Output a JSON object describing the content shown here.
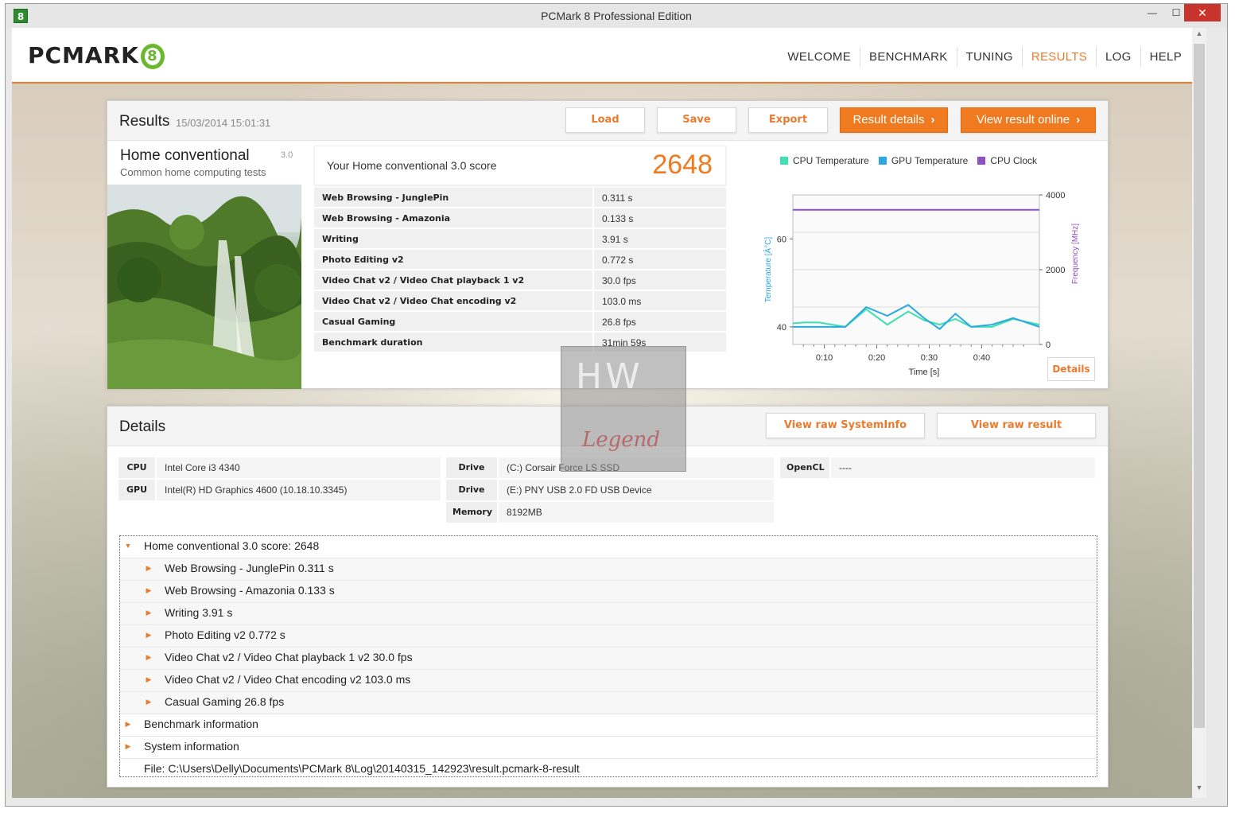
{
  "window": {
    "title": "PCMark 8 Professional Edition",
    "icon_label": "8",
    "controls": {
      "minimize": "—",
      "maximize": "☐",
      "close": "✕"
    }
  },
  "header": {
    "logo_text": "PCMARK",
    "logo_badge": "8",
    "nav": [
      {
        "label": "WELCOME"
      },
      {
        "label": "BENCHMARK"
      },
      {
        "label": "TUNING"
      },
      {
        "label": "RESULTS"
      },
      {
        "label": "LOG"
      },
      {
        "label": "HELP"
      }
    ],
    "active_nav": "RESULTS"
  },
  "results": {
    "title": "Results",
    "date": "15/03/2014 15:01:31",
    "buttons": {
      "load": "Load",
      "save": "Save",
      "export": "Export",
      "result_details": "Result details",
      "view_online": "View result online"
    },
    "test": {
      "name": "Home conventional",
      "version": "3.0",
      "subtitle": "Common home computing tests"
    },
    "score_label": "Your Home conventional 3.0 score",
    "score_value": "2648",
    "rows": [
      {
        "name": "Web Browsing - JunglePin",
        "value": "0.311 s"
      },
      {
        "name": "Web Browsing - Amazonia",
        "value": "0.133 s"
      },
      {
        "name": "Writing",
        "value": "3.91 s"
      },
      {
        "name": "Photo Editing v2",
        "value": "0.772 s"
      },
      {
        "name": "Video Chat v2 / Video Chat playback 1 v2",
        "value": "30.0 fps"
      },
      {
        "name": "Video Chat v2 / Video Chat encoding v2",
        "value": "103.0 ms"
      },
      {
        "name": "Casual Gaming",
        "value": "26.8 fps"
      },
      {
        "name": "Benchmark duration",
        "value": "31min 59s"
      }
    ],
    "chart_details_btn": "Details"
  },
  "chart_data": {
    "type": "line",
    "legend": [
      {
        "name": "CPU Temperature",
        "color": "#3de0b0"
      },
      {
        "name": "GPU Temperature",
        "color": "#29a9e0"
      },
      {
        "name": "CPU Clock",
        "color": "#8e4fc8"
      }
    ],
    "xlabel": "Time [s]",
    "ylabel_left": "Temperature [Â°C]",
    "ylabel_right": "Frequency [MHz]",
    "x_ticks": [
      "0:10",
      "0:20",
      "0:30",
      "0:40"
    ],
    "y_left_ticks": [
      "60",
      "40"
    ],
    "y_right_ticks": [
      "4000",
      "2000",
      "0"
    ],
    "y_left_range": [
      36,
      70
    ],
    "y_right_range": [
      0,
      4000
    ],
    "x_range_s": [
      4,
      51
    ],
    "series": [
      {
        "name": "CPU Temperature",
        "axis": "left",
        "x": [
          4,
          6,
          9,
          14,
          18,
          22,
          26,
          29,
          32,
          35,
          38,
          42,
          46,
          51
        ],
        "y": [
          40.8,
          41.0,
          41.0,
          40.0,
          44.0,
          40.5,
          43.5,
          41.5,
          40.5,
          41.8,
          40.0,
          40.0,
          41.8,
          40.5
        ]
      },
      {
        "name": "GPU Temperature",
        "axis": "left",
        "x": [
          4,
          6,
          9,
          14,
          18,
          22,
          26,
          29,
          32,
          35,
          38,
          42,
          46,
          51
        ],
        "y": [
          40.0,
          40.0,
          40.0,
          40.0,
          44.5,
          42.5,
          45.0,
          42.0,
          39.5,
          43.0,
          40.0,
          40.5,
          42.0,
          40.0
        ]
      },
      {
        "name": "CPU Clock",
        "axis": "right",
        "x": [
          4,
          51
        ],
        "y": [
          3600,
          3600
        ]
      }
    ]
  },
  "details": {
    "title": "Details",
    "buttons": {
      "raw_systeminfo": "View raw SystemInfo",
      "raw_result": "View raw result"
    },
    "system": {
      "cpu_label": "CPU",
      "cpu_value": "Intel Core i3 4340",
      "gpu_label": "GPU",
      "gpu_value": "Intel(R) HD Graphics 4600 (10.18.10.3345)",
      "drive1_label": "Drive",
      "drive1_value": "(C:) Corsair Force LS SSD",
      "drive2_label": "Drive",
      "drive2_value": "(E:) PNY USB 2.0 FD USB Device",
      "memory_label": "Memory",
      "memory_value": "8192MB",
      "opencl_label": "OpenCL",
      "opencl_value": "----"
    },
    "tree": [
      {
        "text": "Home conventional 3.0 score: 2648",
        "level": 0,
        "arrow": "▼"
      },
      {
        "text": "Web Browsing - JunglePin 0.311 s",
        "level": 1,
        "arrow": "▶"
      },
      {
        "text": "Web Browsing - Amazonia 0.133 s",
        "level": 1,
        "arrow": "▶"
      },
      {
        "text": "Writing 3.91 s",
        "level": 1,
        "arrow": "▶"
      },
      {
        "text": "Photo Editing v2 0.772 s",
        "level": 1,
        "arrow": "▶"
      },
      {
        "text": "Video Chat v2 / Video Chat playback 1 v2 30.0 fps",
        "level": 1,
        "arrow": "▶"
      },
      {
        "text": "Video Chat v2 / Video Chat encoding v2 103.0 ms",
        "level": 1,
        "arrow": "▶"
      },
      {
        "text": "Casual Gaming 26.8 fps",
        "level": 1,
        "arrow": "▶"
      },
      {
        "text": "Benchmark information",
        "level": 0,
        "arrow": "▶"
      },
      {
        "text": "System information",
        "level": 0,
        "arrow": "▶"
      },
      {
        "text": "File: C:\\Users\\Delly\\Documents\\PCMark 8\\Log\\20140315_142923\\result.pcmark-8-result",
        "level": 0,
        "arrow": ""
      }
    ]
  },
  "watermark": {
    "top": "HW",
    "bottom": "Legend"
  }
}
